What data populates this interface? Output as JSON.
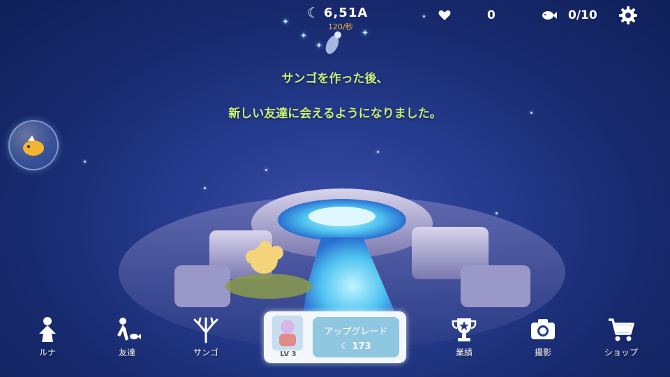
{
  "top": {
    "currency_value": "6,51A",
    "rate": "120/秒",
    "hearts": "0",
    "friends": "0/10"
  },
  "message": {
    "line1": "サンゴを作った後、",
    "line2": "新しい友達に会えるようになりました。"
  },
  "nav": {
    "luna": "ルナ",
    "friends": "友達",
    "coral": "サンゴ",
    "achievements": "業績",
    "photo": "撮影",
    "shop": "ショップ"
  },
  "upgrade": {
    "level": "LV 3",
    "label": "アップグレード",
    "cost": "173"
  },
  "icons": {
    "currency": "moon-icon",
    "hearts": "heart-icon",
    "friends": "fish-icon",
    "settings": "gear-icon"
  },
  "colors": {
    "message": "#c8f07a",
    "rate": "#f0b44a",
    "upgrade_button": "#8fc7e0"
  }
}
